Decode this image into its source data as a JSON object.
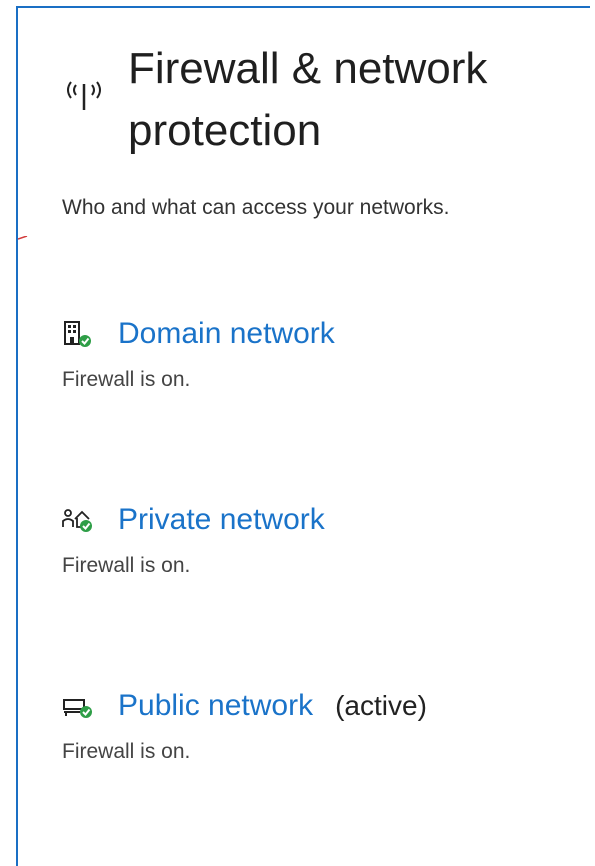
{
  "header": {
    "title": "Firewall & network protection",
    "subtitle": "Who and what can access your networks.",
    "icon": "antenna-broadcast-icon"
  },
  "networks": [
    {
      "label": "Domain network",
      "active_label": "",
      "status": "Firewall is on.",
      "icon": "building-check-icon"
    },
    {
      "label": "Private network",
      "active_label": "",
      "status": "Firewall is on.",
      "icon": "home-people-check-icon"
    },
    {
      "label": "Public network",
      "active_label": "(active)",
      "status": "Firewall is on.",
      "icon": "bench-check-icon"
    }
  ],
  "colors": {
    "link": "#1a73c9",
    "frame_border": "#1a6fc4",
    "check_badge": "#2e9e47",
    "edge_mark": "#d23b3b"
  }
}
